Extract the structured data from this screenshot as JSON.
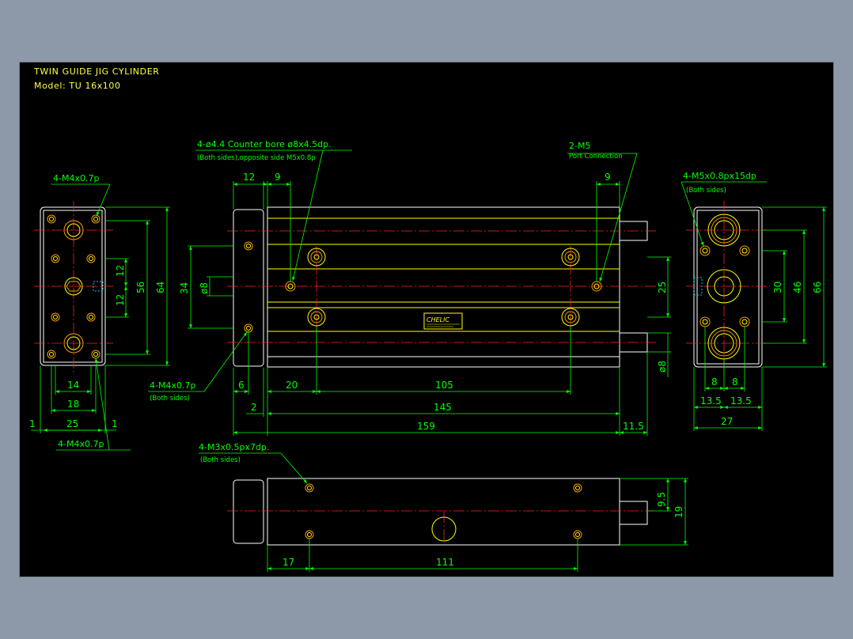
{
  "title_block": {
    "line1": "TWIN GUIDE JIG CYLINDER",
    "line2": "Model:  TU 16x100"
  },
  "colors": {
    "background": "#000000",
    "outline": "#ffffff",
    "inner_lines": "#ffff00",
    "dimensions": "#00ff00",
    "centerlines": "#ff2020",
    "holes": "#ff9a00",
    "title_text": "#ffff44"
  },
  "annotations": {
    "counter_bore_1": "4-ø4.4  Counter bore  ø8x4.5dp.",
    "counter_bore_2": "(Both sides),opposite side M5x0.8p",
    "port_1": "2-M5",
    "port_2": "Port Connection",
    "left_top_thread": "4-M4x0.7p",
    "left_bottom_thread": "4-M4x0.7p",
    "front_left_thread_1": "4-M4x0.7p",
    "front_left_thread_2": "(Both sides)",
    "right_thread_1": "4-M5x0.8px15dp",
    "right_thread_2": "(Both sides)",
    "bottom_thread_1": "4-M3x0.5px7dp.",
    "bottom_thread_2": "(Both sides)",
    "brand_label": "CHELIC"
  },
  "dimensions": {
    "left_view": {
      "h_12_upper": "12",
      "h_12_lower": "12",
      "h_56": "56",
      "h_64": "64",
      "w_14": "14",
      "w_18": "18",
      "w_25": "25",
      "w_1_left": "1",
      "w_1_right": "1"
    },
    "front_view": {
      "top_12": "12",
      "top_9_left": "9",
      "top_9_right": "9",
      "v_34": "34",
      "v_d8_left": "ø8",
      "v_25": "25",
      "v_d8_right": "ø8",
      "b_6": "6",
      "b_20": "20",
      "b_105": "105",
      "b_2": "2",
      "b_145": "145",
      "b_159": "159",
      "b_11_5": "11.5"
    },
    "right_view": {
      "v_30": "30",
      "v_46": "46",
      "v_66": "66",
      "w_8_left": "8",
      "w_8_right": "8",
      "w_13_5_left": "13.5",
      "w_13_5_right": "13.5",
      "w_27": "27"
    },
    "bottom_view": {
      "v_9_5": "9.5",
      "v_19": "19",
      "b_17": "17",
      "b_111": "111"
    }
  }
}
